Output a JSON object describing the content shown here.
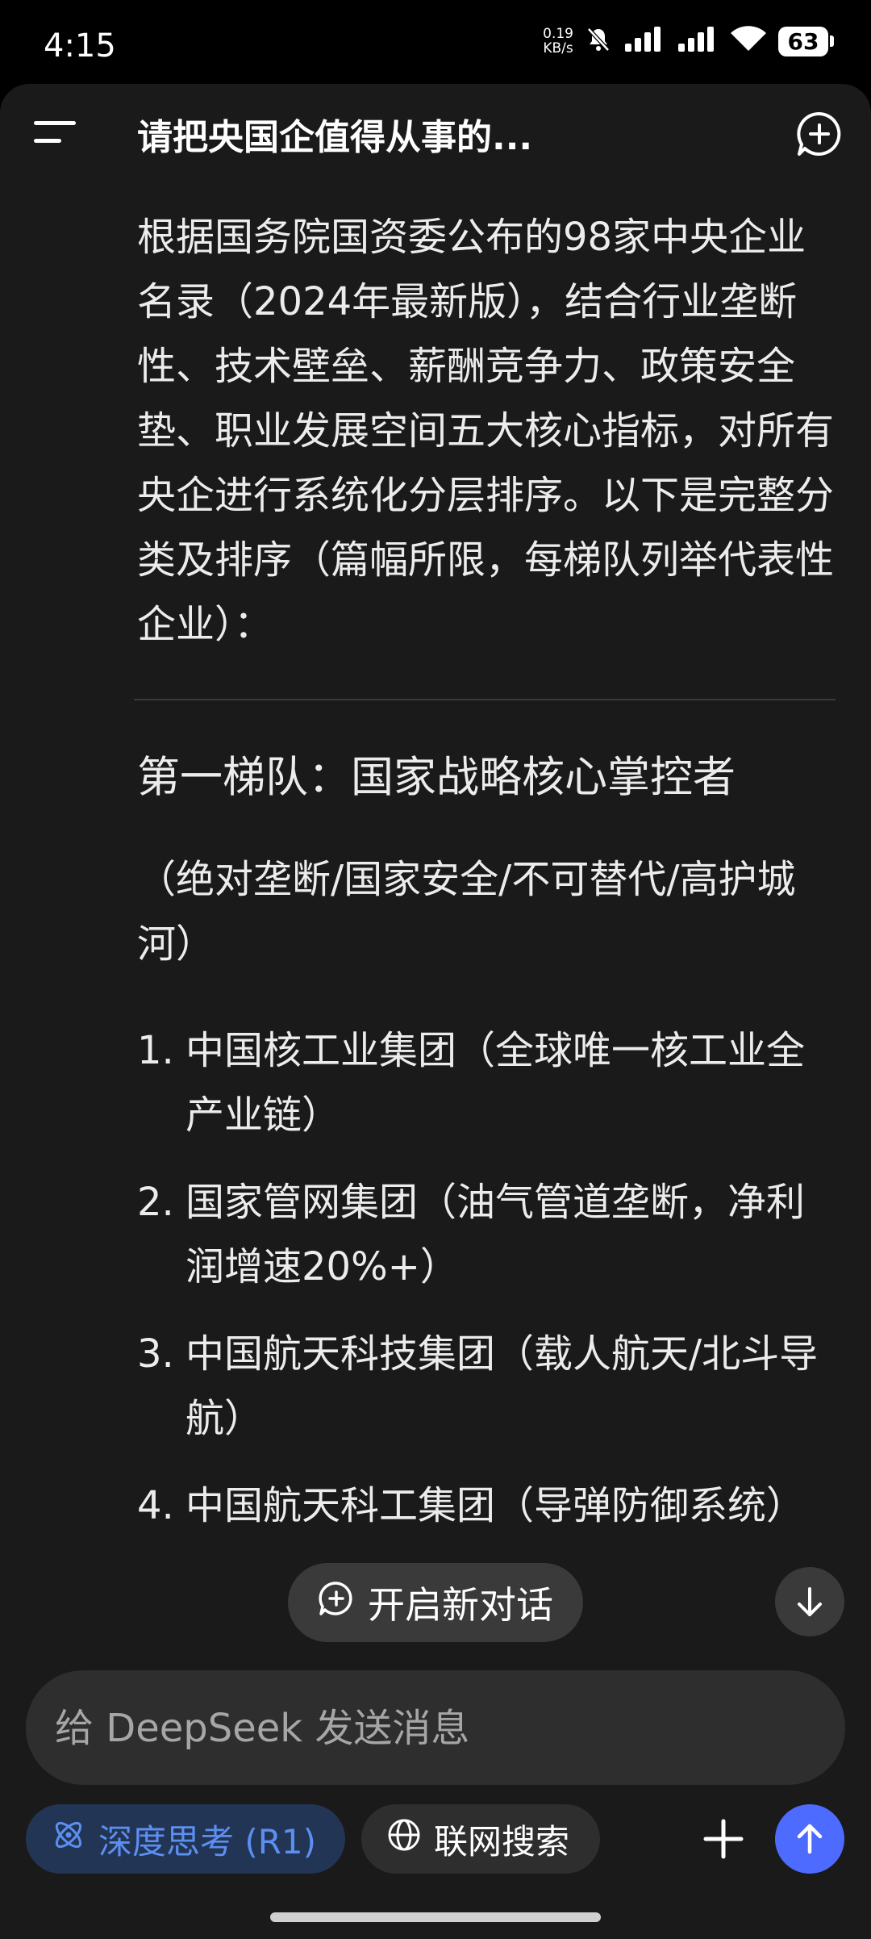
{
  "status": {
    "time": "4:15",
    "net_speed_value": "0.19",
    "net_speed_unit": "KB/s",
    "battery": "63"
  },
  "header": {
    "title": "请把央国企值得从事的..."
  },
  "message": {
    "intro": "根据国务院国资委公布的98家中央企业名录（2024年最新版），结合行业垄断性、技术壁垒、薪酬竞争力、政策安全垫、职业发展空间五大核心指标，对所有央企进行系统化分层排序。以下是完整分类及排序（篇幅所限，每梯队列举代表性企业）：",
    "tier1_title": "第一梯队：国家战略核心掌控者",
    "tier1_desc": "（绝对垄断/国家安全/不可替代/高护城河）",
    "items": [
      {
        "num": "1.",
        "text": "中国核工业集团（全球唯一核工业全产业链）"
      },
      {
        "num": "2.",
        "text": "国家管网集团（油气管道垄断，净利润增速20%+）"
      },
      {
        "num": "3.",
        "text": "中国航天科技集团（载人航天/北斗导航）"
      },
      {
        "num": "4.",
        "text": "中国航天科工集团（导弹防御系统）"
      }
    ]
  },
  "floating": {
    "new_conversation": "开启新对话"
  },
  "composer": {
    "placeholder": "给 DeepSeek 发送消息",
    "deep_think_label": "深度思考 (R1)",
    "web_search_label": "联网搜索"
  },
  "colors": {
    "background": "#1a1a1a",
    "accent_blue": "#4d6bfe",
    "deep_think_text": "#5c8ff2"
  }
}
